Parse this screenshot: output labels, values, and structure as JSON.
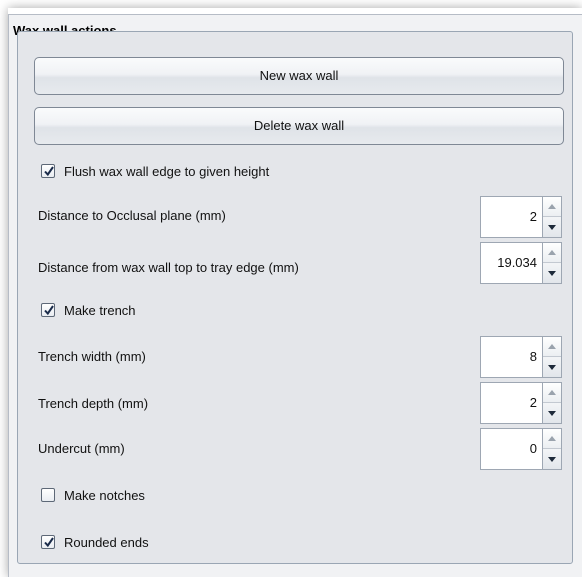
{
  "panel": {
    "title": "Wax wall actions"
  },
  "buttons": {
    "new_wax_wall": "New wax wall",
    "delete_wax_wall": "Delete wax wall"
  },
  "options": {
    "flush_edge": {
      "label": "Flush wax wall edge to given height",
      "checked": true
    },
    "make_trench": {
      "label": "Make trench",
      "checked": true
    },
    "make_notches": {
      "label": "Make notches",
      "checked": false
    },
    "rounded_ends": {
      "label": "Rounded ends",
      "checked": true
    }
  },
  "fields": {
    "distance_occlusal": {
      "label": "Distance to Occlusal plane (mm)",
      "value": "2"
    },
    "distance_tray_edge": {
      "label": "Distance from wax wall top to tray edge (mm)",
      "value": "19.034"
    },
    "trench_width": {
      "label": "Trench width (mm)",
      "value": "8"
    },
    "trench_depth": {
      "label": "Trench depth (mm)",
      "value": "2"
    },
    "undercut": {
      "label": "Undercut (mm)",
      "value": "0"
    }
  },
  "colors": {
    "panel_bg": "#f1f2f4",
    "group_bg": "#e4e6ea",
    "check_mark": "#1a2b4a"
  }
}
